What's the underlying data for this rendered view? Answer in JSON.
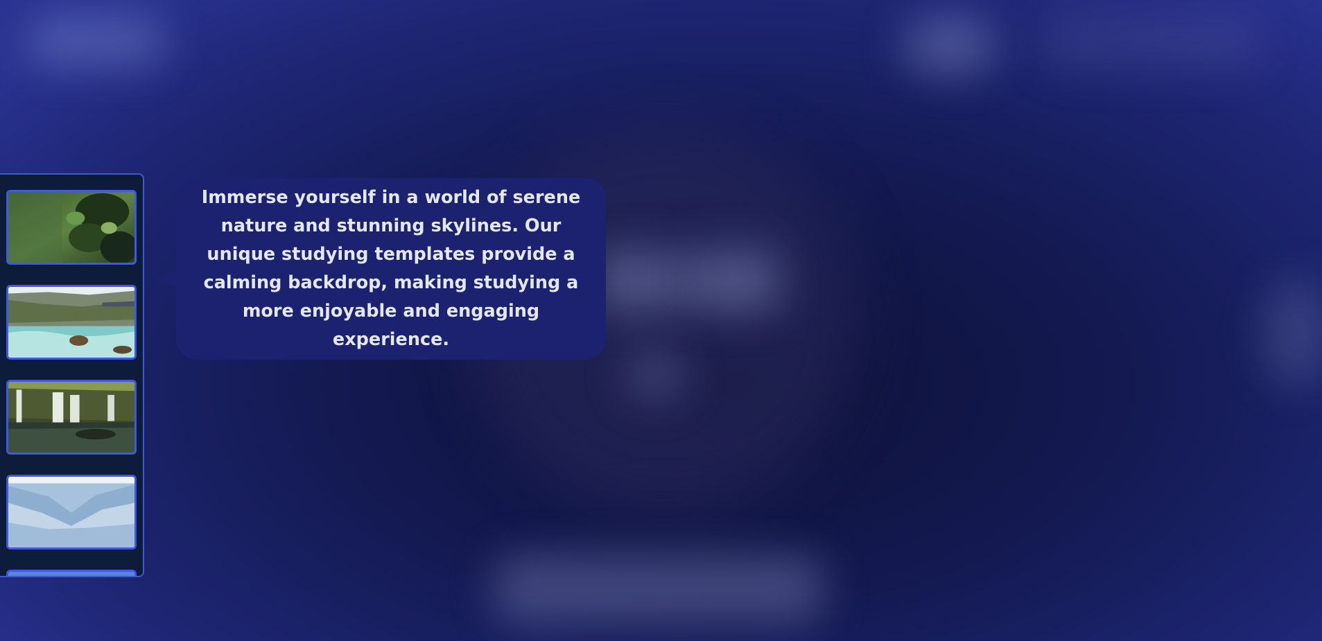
{
  "tooltip": {
    "text": "Immerse yourself in a world of serene nature and stunning skylines. Our unique studying templates provide a calming backdrop, making studying a more enjoyable and engaging experience."
  },
  "thumbnails": [
    {
      "icon": "forest-leaves-thumbnail"
    },
    {
      "icon": "river-rapids-thumbnail"
    },
    {
      "icon": "waterfall-thumbnail"
    },
    {
      "icon": "snowy-forest-thumbnail"
    },
    {
      "icon": "partial-thumbnail"
    }
  ],
  "colors": {
    "background_deep": "#0d1138",
    "background_edge": "#2a3391",
    "panel_bg": "#0e1c3c",
    "panel_border": "#3f58d8",
    "tooltip_bg": "#1c2270",
    "tooltip_text": "#e4e7f6"
  }
}
